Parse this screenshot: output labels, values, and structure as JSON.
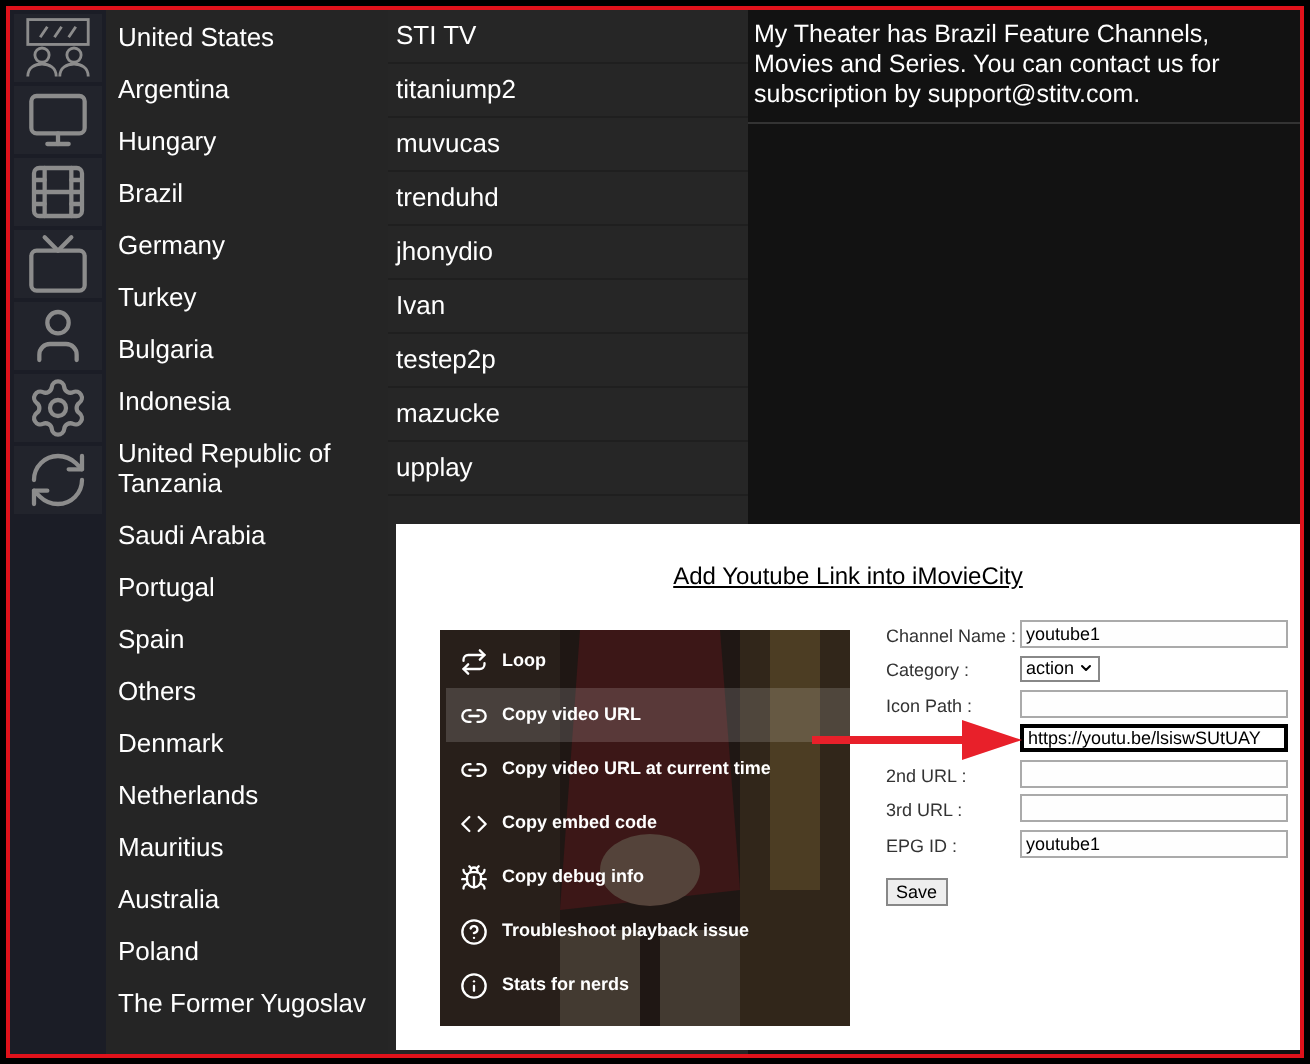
{
  "sidebar": {
    "icons": [
      {
        "kind": "theater"
      },
      {
        "kind": "monitor"
      },
      {
        "kind": "film"
      },
      {
        "kind": "tv"
      },
      {
        "kind": "user"
      },
      {
        "kind": "settings"
      },
      {
        "kind": "refresh"
      }
    ]
  },
  "countries": [
    "United States",
    "Argentina",
    "Hungary",
    "Brazil",
    "Germany",
    "Turkey",
    "Bulgaria",
    "Indonesia",
    "United Republic of Tanzania",
    "Saudi Arabia",
    "Portugal",
    "Spain",
    "Others",
    "Denmark",
    "Netherlands",
    "Mauritius",
    "Australia",
    "Poland",
    "The Former Yugoslav"
  ],
  "channels": [
    "STI TV",
    "titaniump2",
    "muvucas",
    "trenduhd",
    "jhonydio",
    "Ivan",
    "testep2p",
    "mazucke",
    "upplay"
  ],
  "description": "My Theater has Brazil Feature Channels, Movies and Series. You can contact us for subscription by support@stitv.com.",
  "inset": {
    "title": "Add Youtube Link into iMovieCity",
    "video_menu": [
      {
        "kind": "loop",
        "label": "Loop",
        "selected": false
      },
      {
        "kind": "link",
        "label": "Copy video URL",
        "selected": true
      },
      {
        "kind": "link",
        "label": "Copy video URL at current time",
        "selected": false
      },
      {
        "kind": "code",
        "label": "Copy embed code",
        "selected": false
      },
      {
        "kind": "bug",
        "label": "Copy debug info",
        "selected": false
      },
      {
        "kind": "help",
        "label": "Troubleshoot playback issue",
        "selected": false
      },
      {
        "kind": "info",
        "label": "Stats for nerds",
        "selected": false
      }
    ],
    "form": [
      {
        "kind": "text",
        "label": "Channel Name :",
        "value": "youtube1",
        "focused": false
      },
      {
        "kind": "select",
        "label": "Category :",
        "value": "action",
        "focused": false
      },
      {
        "kind": "text",
        "label": "Icon Path :",
        "focused": false
      },
      {
        "kind": "text",
        "value": "https://youtu.be/lsiswSUtUAY",
        "focused": true
      },
      {
        "kind": "text",
        "label": "2nd URL :",
        "focused": false
      },
      {
        "kind": "text",
        "label": "3rd URL :",
        "focused": false
      },
      {
        "kind": "text",
        "label": "EPG ID :",
        "value": "youtube1",
        "focused": false
      }
    ],
    "save_button": "Save"
  }
}
